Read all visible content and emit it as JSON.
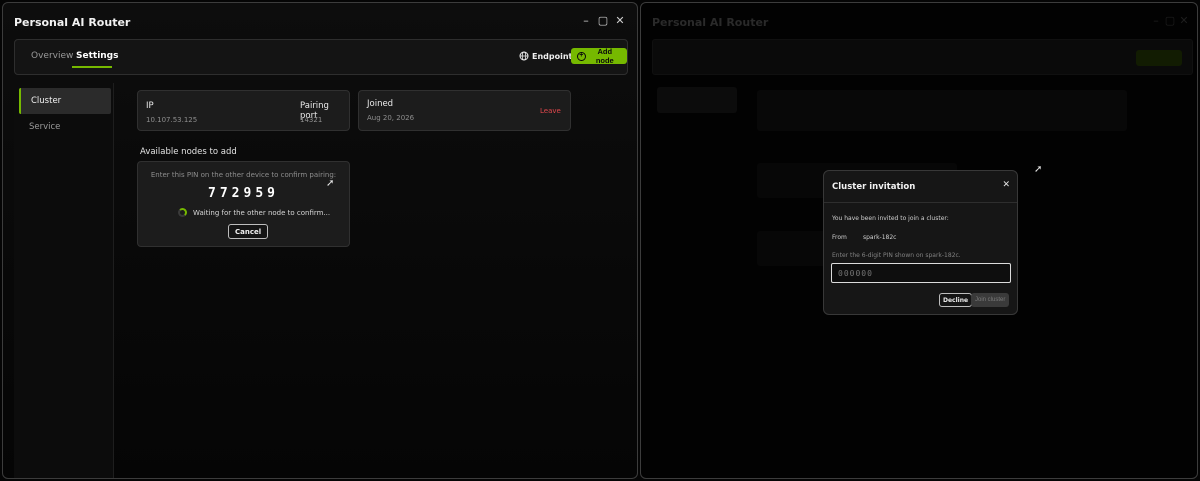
{
  "colors": {
    "accent": "#76b900",
    "danger": "#e0474c",
    "background": "#050505"
  },
  "left_window": {
    "title": "Personal AI Router",
    "controls": {
      "minimize": "–",
      "maximize": "▢",
      "close": "✕"
    },
    "tabs": [
      {
        "label": "Overview"
      },
      {
        "label": "Settings"
      }
    ],
    "active_tab": "Settings",
    "endpoints_label": "Endpoints",
    "add_node_label": "Add node",
    "sidebar": [
      {
        "label": "Cluster"
      },
      {
        "label": "Service"
      }
    ],
    "active_sidebar": "Cluster",
    "node_card": {
      "ip_label": "IP",
      "ip_value": "10.107.53.125",
      "port_label": "Pairing port",
      "port_value": "14321"
    },
    "joined_card": {
      "label": "Joined",
      "date": "Aug 20, 2026",
      "leave_label": "Leave"
    },
    "available_heading": "Available nodes to add",
    "pairing": {
      "instruction": "Enter this PIN on the other device to confirm pairing:",
      "pin": "772959",
      "waiting": "Waiting for the other node to confirm...",
      "cancel_label": "Cancel"
    }
  },
  "right_window": {
    "title": "Personal AI Router",
    "dialog": {
      "title": "Cluster invitation",
      "close": "✕",
      "invited_text": "You have been invited to join a cluster:",
      "from_label": "From",
      "from_value": "spark-182c",
      "pin_instruction": "Enter the 6-digit PIN shown on spark-182c.",
      "pin_placeholder": "000000",
      "decline_label": "Decline",
      "join_label": "Join cluster"
    }
  }
}
